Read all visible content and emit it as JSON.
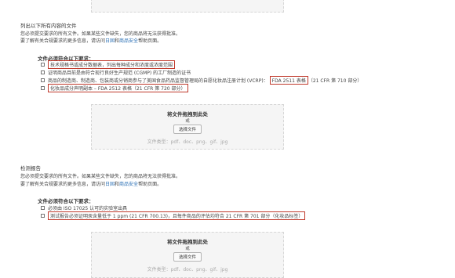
{
  "top_zone": {},
  "section1": {
    "heading": "列出以下所有内容的文件",
    "para1": "您必须提交要求的所有文件。如果某些文件缺失，您的商品将无法获得批准。",
    "para2_prefix": "要了解有关合规要求的更多信息，请访问",
    "para2_link1": "日固",
    "para2_mid": "和",
    "para2_link2": "商品安全",
    "para2_suffix": "帮助页面。",
    "req_head": "文件必须符合以下要求：",
    "items": [
      "技术规格书或成分数据表，列出每种成分和浓度或浓度范围",
      "证明商品目前是由符合现行良好生产规范 (CGMP) 的工厂制造的证书",
      "商品的制造商、制造商、包装商或分销商参与了美国食品药品监督管理局的自愿化妆品注册计划 (VCRP)：",
      "化妆品成分声明副本 – FDA 2512 表格（21 CFR 第 720 部分）"
    ],
    "item3_highlight": "FDA 2511 表格",
    "item3_tail": "（21 CFR 第 710 部分）",
    "dropzone": {
      "title": "将文件拖拽到此处",
      "or": "或",
      "button": "选择文件",
      "types": "文件类型：pdf、doc、png、gif、jpg"
    }
  },
  "section2": {
    "heading": "检测报告",
    "para1": "您必须提交要求的所有文件。如果某些文件缺失，您的商品将无法获得批准。",
    "para2_prefix": "要了解有关合规要求的更多信息，请访问",
    "para2_link1": "日固",
    "para2_mid": "和",
    "para2_link2": "商品安全",
    "para2_suffix": "帮助页面。",
    "req_head": "文件必须符合以下要求：",
    "items": [
      "必须由 ISO 17025 认可的实验室出具",
      "测试报告必须证明汞含量低于 1 ppm (21 CFR 700.13)，且每件商品的评估均符合 21 CFR 第 701 部分（化妆品标签）"
    ],
    "dropzone": {
      "title": "将文件拖拽到此处",
      "or": "或",
      "button": "选择文件",
      "types": "文件类型：pdf、doc、png、gif、jpg"
    }
  },
  "colors": {
    "highlight_border": "#c0392b",
    "link": "#2a6fb5",
    "dropzone_bg": "#f5f5f5"
  }
}
